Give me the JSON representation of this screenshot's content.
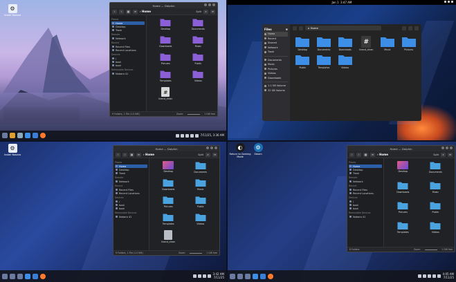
{
  "q1": {
    "desktop_icon": "Install Nobara",
    "window": {
      "title": "Home — Dolphin",
      "breadcrumb": "Home",
      "split_label": "Split",
      "sidebar": [
        {
          "type": "section",
          "label": "Places"
        },
        {
          "type": "item",
          "label": "Home",
          "selected": true
        },
        {
          "type": "item",
          "label": "Desktop"
        },
        {
          "type": "item",
          "label": "Trash"
        },
        {
          "type": "section",
          "label": "Remote"
        },
        {
          "type": "item",
          "label": "Network"
        },
        {
          "type": "section",
          "label": "Recent"
        },
        {
          "type": "item",
          "label": "Recent Files"
        },
        {
          "type": "item",
          "label": "Recent Locations"
        },
        {
          "type": "section",
          "label": "Devices"
        },
        {
          "type": "item",
          "label": "/"
        },
        {
          "type": "item",
          "label": "boot"
        },
        {
          "type": "item",
          "label": "boot"
        },
        {
          "type": "section",
          "label": "Removable Devices"
        },
        {
          "type": "item",
          "label": "Nobara 41"
        }
      ],
      "files": [
        {
          "name": "Desktop",
          "kind": "folder",
          "color": "#8b5fd6"
        },
        {
          "name": "Documents",
          "kind": "folder",
          "color": "#8b5fd6"
        },
        {
          "name": "Downloads",
          "kind": "folder",
          "color": "#8b5fd6"
        },
        {
          "name": "Music",
          "kind": "folder",
          "color": "#8b5fd6"
        },
        {
          "name": "Pictures",
          "kind": "folder",
          "color": "#8b5fd6"
        },
        {
          "name": "Public",
          "kind": "folder",
          "color": "#8b5fd6"
        },
        {
          "name": "Templates",
          "kind": "folder",
          "color": "#8b5fd6"
        },
        {
          "name": "Videos",
          "kind": "folder",
          "color": "#8b5fd6"
        },
        {
          "name": "livecd_clean",
          "kind": "exe",
          "glyph": "#"
        }
      ],
      "status": "9 Folders, 1 File (1.0 KiB)",
      "zoom_label": "Zoom:",
      "free_space": "1 GiB free"
    },
    "clock": "7/11/25, 3:36 AM"
  },
  "q2": {
    "topbar_date": "Jan 1",
    "topbar_time": "3:47 AM",
    "window": {
      "sidebar_title": "Files",
      "path": "Home",
      "sidebar": [
        {
          "label": "Home",
          "selected": true
        },
        {
          "label": "Recent"
        },
        {
          "label": "Starred"
        },
        {
          "label": "Network"
        },
        {
          "label": "Trash"
        },
        {
          "sep": true
        },
        {
          "label": "Documents"
        },
        {
          "label": "Music"
        },
        {
          "label": "Pictures"
        },
        {
          "label": "Videos"
        },
        {
          "label": "Downloads"
        },
        {
          "sep": true
        },
        {
          "label": "1.1 GB Volume"
        },
        {
          "label": "32 GB Volume"
        }
      ],
      "files": [
        {
          "name": "Desktop",
          "kind": "folder",
          "color": "#3d8ee6"
        },
        {
          "name": "Documents",
          "kind": "folder",
          "color": "#3d8ee6"
        },
        {
          "name": "Downloads",
          "kind": "folder",
          "color": "#3d8ee6"
        },
        {
          "name": "livecd_clean",
          "kind": "exe",
          "glyph": "#"
        },
        {
          "name": "Music",
          "kind": "folder",
          "color": "#3d8ee6"
        },
        {
          "name": "Pictures",
          "kind": "folder",
          "color": "#3d8ee6"
        },
        {
          "name": "Public",
          "kind": "folder",
          "color": "#3d8ee6"
        },
        {
          "name": "Templates",
          "kind": "folder",
          "color": "#3d8ee6"
        },
        {
          "name": "Videos",
          "kind": "folder",
          "color": "#3d8ee6"
        }
      ]
    }
  },
  "q3": {
    "desktop_icon": "Install Nobara",
    "window": {
      "title": "Home — Dolphin",
      "breadcrumb": "Home",
      "split_label": "Split",
      "sidebar": [
        {
          "type": "section",
          "label": "Places"
        },
        {
          "type": "item",
          "label": "Home",
          "selected": true
        },
        {
          "type": "item",
          "label": "Desktop"
        },
        {
          "type": "item",
          "label": "Trash"
        },
        {
          "type": "section",
          "label": "Remote"
        },
        {
          "type": "item",
          "label": "Network"
        },
        {
          "type": "section",
          "label": "Recent"
        },
        {
          "type": "item",
          "label": "Recent Files"
        },
        {
          "type": "item",
          "label": "Recent Locations"
        },
        {
          "type": "section",
          "label": "Devices"
        },
        {
          "type": "item",
          "label": "/"
        },
        {
          "type": "item",
          "label": "boot"
        },
        {
          "type": "item",
          "label": "boot"
        },
        {
          "type": "section",
          "label": "Removable Devices"
        },
        {
          "type": "item",
          "label": "Nobara 41"
        }
      ],
      "files": [
        {
          "name": "Desktop",
          "kind": "desk"
        },
        {
          "name": "Documents",
          "kind": "folder",
          "color": "#4aa3df"
        },
        {
          "name": "Downloads",
          "kind": "folder",
          "color": "#4aa3df"
        },
        {
          "name": "Music",
          "kind": "folder",
          "color": "#4aa3df"
        },
        {
          "name": "Pictures",
          "kind": "folder",
          "color": "#4aa3df"
        },
        {
          "name": "Public",
          "kind": "folder",
          "color": "#4aa3df"
        },
        {
          "name": "Templates",
          "kind": "folder",
          "color": "#4aa3df"
        },
        {
          "name": "Videos",
          "kind": "folder",
          "color": "#4aa3df"
        },
        {
          "name": "livecd_clean",
          "kind": "doc"
        }
      ],
      "status": "9 Folders, 1 File (1.0 KiB)",
      "zoom_label": "Zoom:",
      "free_space": "1 GiB free"
    },
    "clock_time": "3:42 AM",
    "clock_date": "7/11/25"
  },
  "q4": {
    "desktop_icons": [
      {
        "label": "Return to Gaming Mode"
      },
      {
        "label": "Steam"
      }
    ],
    "window": {
      "title": "Home — Dolphin",
      "breadcrumb": "Home",
      "split_label": "Split",
      "sidebar": [
        {
          "type": "section",
          "label": "Places"
        },
        {
          "type": "item",
          "label": "Home",
          "selected": true
        },
        {
          "type": "item",
          "label": "Desktop"
        },
        {
          "type": "item",
          "label": "Trash"
        },
        {
          "type": "section",
          "label": "Remote"
        },
        {
          "type": "item",
          "label": "Network"
        },
        {
          "type": "section",
          "label": "Recent"
        },
        {
          "type": "item",
          "label": "Recent Files"
        },
        {
          "type": "item",
          "label": "Recent Locations"
        },
        {
          "type": "section",
          "label": "Devices"
        },
        {
          "type": "item",
          "label": "/"
        },
        {
          "type": "item",
          "label": "boot"
        },
        {
          "type": "item",
          "label": "boot"
        },
        {
          "type": "section",
          "label": "Removable Devices"
        },
        {
          "type": "item",
          "label": "Nobara 41"
        }
      ],
      "files": [
        {
          "name": "Desktop",
          "kind": "desk"
        },
        {
          "name": "Documents",
          "kind": "folder",
          "color": "#4aa3df"
        },
        {
          "name": "Downloads",
          "kind": "folder",
          "color": "#4aa3df"
        },
        {
          "name": "Music",
          "kind": "folder",
          "color": "#4aa3df"
        },
        {
          "name": "Pictures",
          "kind": "folder",
          "color": "#4aa3df"
        },
        {
          "name": "Public",
          "kind": "folder",
          "color": "#4aa3df"
        },
        {
          "name": "Templates",
          "kind": "folder",
          "color": "#4aa3df"
        },
        {
          "name": "Videos",
          "kind": "folder",
          "color": "#4aa3df"
        }
      ],
      "status": "8 Folders",
      "zoom_label": "Zoom:",
      "free_space": "1 GiB free"
    },
    "clock_time": "4:05 AM",
    "clock_date": "7/11/25"
  }
}
